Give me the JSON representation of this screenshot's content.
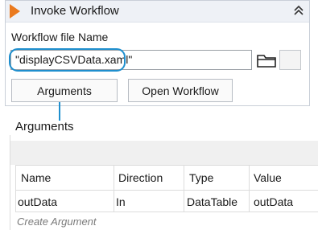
{
  "activity": {
    "title": "Invoke Workflow",
    "file_label": "Workflow file Name",
    "file_value": "\"displayCSVData.xaml\"",
    "arguments_button": "Arguments",
    "open_button": "Open Workflow"
  },
  "icons": {
    "activity": "play-icon",
    "collapse": "double-chevron-up-icon",
    "browse": "folder-icon"
  },
  "colors": {
    "accent_orange": "#ea7a1e",
    "highlight_blue": "#1f8fce",
    "header_bg": "#eef1f6"
  },
  "arguments_panel": {
    "title": "Arguments",
    "columns": [
      "Name",
      "Direction",
      "Type",
      "Value"
    ],
    "rows": [
      {
        "name": "outData",
        "direction": "In",
        "type": "DataTable",
        "value": "outData"
      }
    ],
    "create_label": "Create Argument"
  }
}
